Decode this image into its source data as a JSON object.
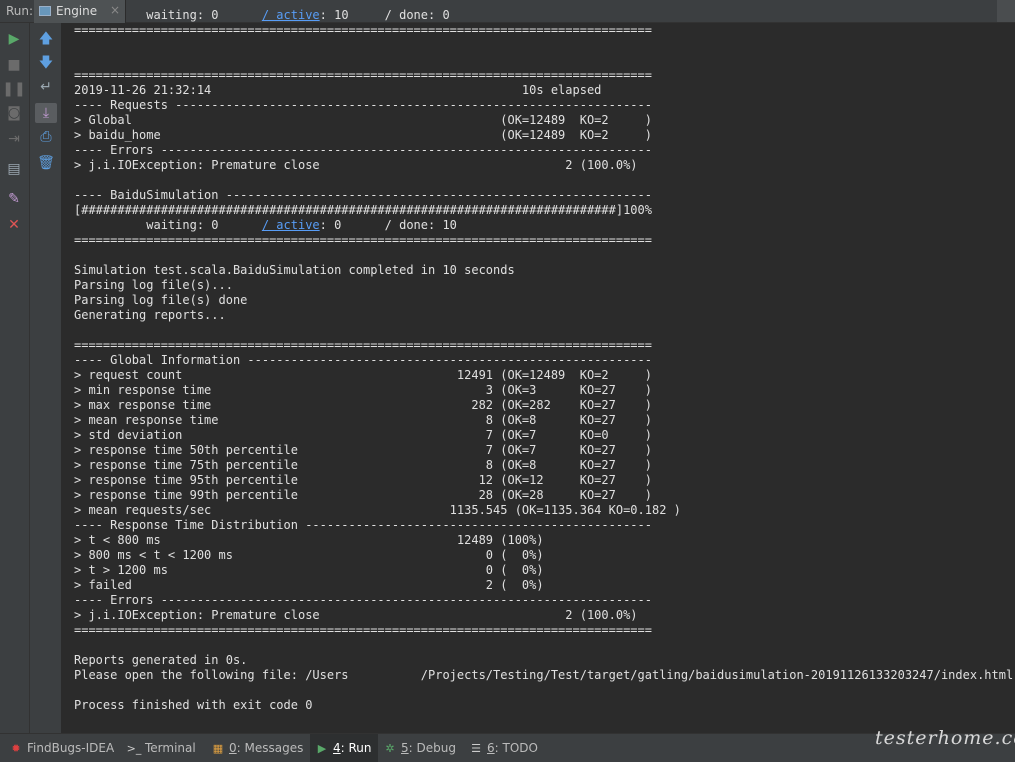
{
  "run_panel": {
    "label": "Run:",
    "tab_title": "Engine",
    "tab_close": "×"
  },
  "console": {
    "lines": [
      {
        "text": "          waiting: 0      / active: 10     / done: 0"
      },
      {
        "text": "================================================================================"
      },
      {
        "text": ""
      },
      {
        "text": ""
      },
      {
        "text": "================================================================================"
      },
      {
        "text": "2019-11-26 21:32:14                                           10s elapsed"
      },
      {
        "text": "---- Requests ------------------------------------------------------------------"
      },
      {
        "text": "> Global                                                   (OK=12489  KO=2     )"
      },
      {
        "text": "> baidu_home                                               (OK=12489  KO=2     )"
      },
      {
        "text": "---- Errors --------------------------------------------------------------------"
      },
      {
        "text": "> j.i.IOException: Premature close                                  2 (100.0%)"
      },
      {
        "text": ""
      },
      {
        "text": "---- BaiduSimulation -----------------------------------------------------------"
      },
      {
        "text": "[##########################################################################]100%"
      },
      {
        "text": "          waiting: 0      / active: 0      / done: 10"
      },
      {
        "text": "================================================================================"
      },
      {
        "text": ""
      },
      {
        "text": "Simulation test.scala.BaiduSimulation completed in 10 seconds"
      },
      {
        "text": "Parsing log file(s)..."
      },
      {
        "text": "Parsing log file(s) done"
      },
      {
        "text": "Generating reports..."
      },
      {
        "text": ""
      },
      {
        "text": "================================================================================"
      },
      {
        "text": "---- Global Information --------------------------------------------------------"
      },
      {
        "text": "> request count                                      12491 (OK=12489  KO=2     )"
      },
      {
        "text": "> min response time                                      3 (OK=3      KO=27    )"
      },
      {
        "text": "> max response time                                    282 (OK=282    KO=27    )"
      },
      {
        "text": "> mean response time                                     8 (OK=8      KO=27    )"
      },
      {
        "text": "> std deviation                                          7 (OK=7      KO=0     )"
      },
      {
        "text": "> response time 50th percentile                          7 (OK=7      KO=27    )"
      },
      {
        "text": "> response time 75th percentile                          8 (OK=8      KO=27    )"
      },
      {
        "text": "> response time 95th percentile                         12 (OK=12     KO=27    )"
      },
      {
        "text": "> response time 99th percentile                         28 (OK=28     KO=27    )"
      },
      {
        "text": "> mean requests/sec                                 1135.545 (OK=1135.364 KO=0.182 )"
      },
      {
        "text": "---- Response Time Distribution ------------------------------------------------"
      },
      {
        "text": "> t < 800 ms                                         12489 (100%)"
      },
      {
        "text": "> 800 ms < t < 1200 ms                                   0 (  0%)"
      },
      {
        "text": "> t > 1200 ms                                            0 (  0%)"
      },
      {
        "text": "> failed                                                 2 (  0%)"
      },
      {
        "text": "---- Errors --------------------------------------------------------------------"
      },
      {
        "text": "> j.i.IOException: Premature close                                  2 (100.0%)"
      },
      {
        "text": "================================================================================"
      },
      {
        "text": ""
      },
      {
        "text": "Reports generated in 0s."
      },
      {
        "text": "Please open the following file: /Users          /Projects/Testing/Test/target/gatling/baidusimulation-20191126133203247/index.html"
      },
      {
        "text": ""
      },
      {
        "text": "Process finished with exit code 0"
      }
    ]
  },
  "left_toolbar_1": [
    {
      "name": "rerun-icon",
      "glyph": "▶",
      "color": "#59a869"
    },
    {
      "name": "stop-icon",
      "glyph": "■",
      "color": "#6b6b6b"
    },
    {
      "name": "pause-icon",
      "glyph": "❚❚",
      "color": "#6b6b6b"
    },
    {
      "name": "camera-icon",
      "glyph": "◙",
      "color": "#6b6b6b"
    },
    {
      "name": "exit-icon",
      "glyph": "⇥",
      "color": "#6b6b6b"
    },
    {
      "name": "layout-icon",
      "glyph": "▤",
      "color": "#9aa7b0"
    },
    {
      "name": "pin-icon",
      "glyph": "✎",
      "color": "#c39bd3"
    },
    {
      "name": "close-icon",
      "glyph": "✕",
      "color": "#e05555"
    }
  ],
  "left_toolbar_2": [
    {
      "name": "arrow-up-icon",
      "glyph": "🡅",
      "color": "#5e9fe0"
    },
    {
      "name": "arrow-down-icon",
      "glyph": "🡇",
      "color": "#5e9fe0"
    },
    {
      "name": "soft-wrap-icon",
      "glyph": "↵",
      "color": "#9aa7b0"
    },
    {
      "name": "scroll-to-end-icon",
      "glyph": "⤓",
      "color": "#c39bd3"
    },
    {
      "name": "print-icon",
      "glyph": "⎙",
      "color": "#5e9fe0"
    },
    {
      "name": "trash-icon",
      "glyph": "🗑",
      "color": "#5e9fe0"
    }
  ],
  "bottom_tabs": [
    {
      "name": "findbugs",
      "number": "",
      "label": "FindBugs-IDEA",
      "icon": "findbugs-icon",
      "glyph": "✹",
      "color": "#e04040"
    },
    {
      "name": "terminal",
      "number": "",
      "label": "Terminal",
      "icon": "terminal-icon",
      "glyph": ">_",
      "color": "#cccccc"
    },
    {
      "name": "messages",
      "number": "0",
      "label": ": Messages",
      "icon": "messages-icon",
      "glyph": "▦",
      "color": "#e0a040"
    },
    {
      "name": "run",
      "number": "4",
      "label": ": Run",
      "icon": "run-icon",
      "glyph": "▶",
      "color": "#59a869"
    },
    {
      "name": "debug",
      "number": "5",
      "label": ": Debug",
      "icon": "debug-icon",
      "glyph": "✲",
      "color": "#59a869"
    },
    {
      "name": "todo",
      "number": "6",
      "label": ": TODO",
      "icon": "todo-icon",
      "glyph": "☰",
      "color": "#cccccc"
    }
  ],
  "watermark": "testerhome.com"
}
